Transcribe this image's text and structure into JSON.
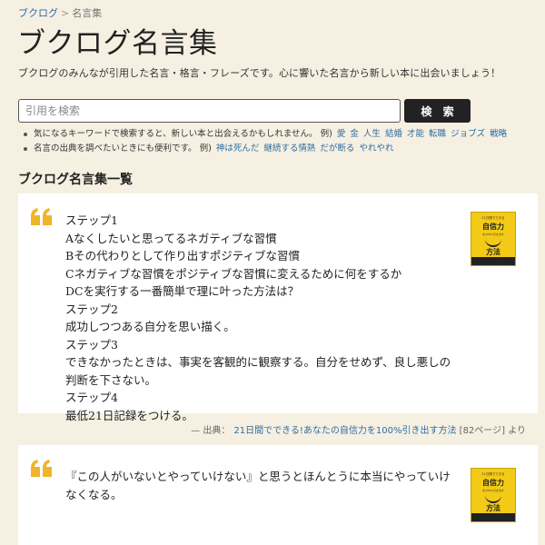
{
  "breadcrumb": {
    "home": "ブクログ",
    "separator": ">",
    "current": "名言集"
  },
  "page": {
    "title": "ブクログ名言集",
    "description": "ブクログのみんなが引用した名言・格言・フレーズです。心に響いた名言から新しい本に出会いましょう！"
  },
  "search": {
    "placeholder": "引用を検索",
    "value": "",
    "button_label": "検 索"
  },
  "tips": [
    {
      "text": "気になるキーワードで検索すると、新しい本と出会えるかもしれません。 例)",
      "keywords": [
        "愛",
        "金",
        "人生",
        "結婚",
        "才能",
        "転職",
        "ジョブズ",
        "戦略"
      ]
    },
    {
      "text": "名言の出典を調べたいときにも便利です。 例)",
      "keywords": [
        "神は死んだ",
        "継続する情熱",
        "だが断る",
        "やれやれ"
      ]
    }
  ],
  "section": {
    "title": "ブクログ名言集一覧"
  },
  "quotes": [
    {
      "lines": [
        "ステップ1",
        "Aなくしたいと思ってるネガティブな習慣",
        "Bその代わりとして作り出すポジティブな習慣",
        "Cネガティブな習慣をポジティブな習慣に変えるために何をするか",
        "DCを実行する一番簡単で理に叶った方法は？",
        "ステップ2",
        "成功しつつある自分を思い描く。",
        "ステップ3",
        "できなかったときは、事実を客観的に観察する。自分をせめず、良し悪しの",
        "判断を下さない。",
        "ステップ4",
        "最低21日記録をつける。"
      ],
      "source_prefix": "— 出典：",
      "source_title": "21日間でできる!あなたの自信力を100%引き出す方法",
      "source_page": "[82ページ]",
      "source_suffix": "より",
      "cover": {
        "top_text": "21日間でできる",
        "title": "自信力",
        "sub_text": "を100%引き出す",
        "method": "方法",
        "color": "#f3cb16"
      }
    },
    {
      "lines": [
        "『この人がいないとやっていけない』と思うとほんとうに本当にやっていけ",
        "なくなる。"
      ],
      "cover": {
        "top_text": "21日間でできる",
        "title": "自信力",
        "sub_text": "を100%引き出す",
        "method": "方法",
        "color": "#f3cb16"
      }
    }
  ],
  "icons": {
    "quote": "quote-icon"
  },
  "colors": {
    "background": "#f6f0e2",
    "link": "#2d6da3",
    "quote_mark": "#f0b429",
    "button": "#222222"
  }
}
